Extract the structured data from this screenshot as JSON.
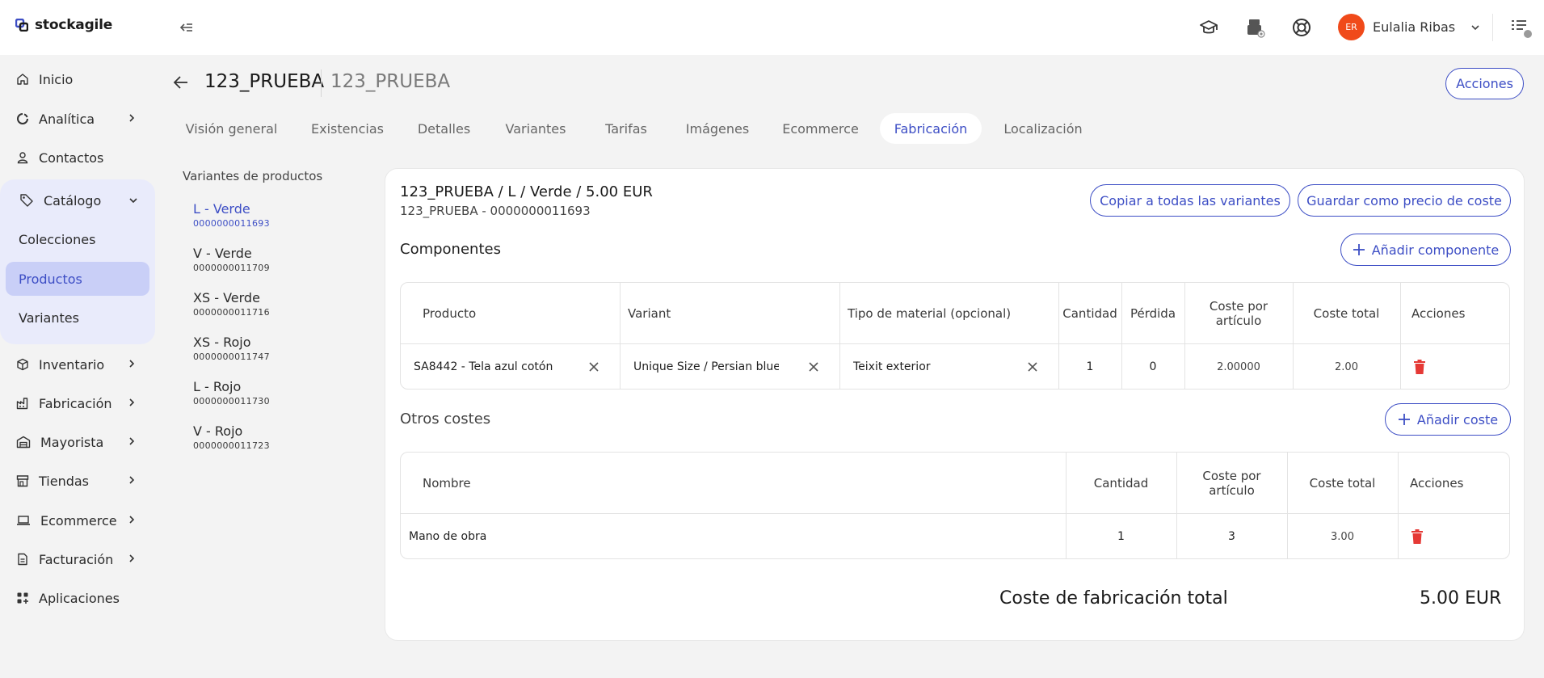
{
  "app": {
    "name": "stockagile"
  },
  "user": {
    "initials": "ER",
    "name": "Eulalia Ribas"
  },
  "colors": {
    "accent": "#3d4ec5",
    "avatar": "#f04a1a",
    "danger": "#e53935"
  },
  "sidebar": {
    "items": [
      {
        "label": "Inicio",
        "icon": "home-icon"
      },
      {
        "label": "Analítica",
        "icon": "analytics-icon"
      },
      {
        "label": "Contactos",
        "icon": "person-icon"
      },
      {
        "label": "Catálogo",
        "icon": "tag-icon"
      },
      {
        "label": "Inventario",
        "icon": "box-icon"
      },
      {
        "label": "Fabricación",
        "icon": "factory-icon"
      },
      {
        "label": "Mayorista",
        "icon": "warehouse-icon"
      },
      {
        "label": "Tiendas",
        "icon": "store-icon"
      },
      {
        "label": "Ecommerce",
        "icon": "laptop-icon"
      },
      {
        "label": "Facturación",
        "icon": "invoice-icon"
      },
      {
        "label": "Aplicaciones",
        "icon": "apps-icon"
      }
    ],
    "catalog_sub": [
      {
        "label": "Colecciones"
      },
      {
        "label": "Productos"
      },
      {
        "label": "Variantes"
      }
    ]
  },
  "header": {
    "title": "123_PRUEBA",
    "subtitle": "123_PRUEBA",
    "actions_label": "Acciones"
  },
  "tabs": [
    {
      "label": "Visión general"
    },
    {
      "label": "Existencias"
    },
    {
      "label": "Detalles"
    },
    {
      "label": "Variantes"
    },
    {
      "label": "Tarifas"
    },
    {
      "label": "Imágenes"
    },
    {
      "label": "Ecommerce"
    },
    {
      "label": "Fabricación"
    },
    {
      "label": "Localización"
    }
  ],
  "variants": {
    "heading": "Variantes de productos",
    "items": [
      {
        "name": "L - Verde",
        "code": "0000000011693"
      },
      {
        "name": "V - Verde",
        "code": "0000000011709"
      },
      {
        "name": "XS - Verde",
        "code": "0000000011716"
      },
      {
        "name": "XS - Rojo",
        "code": "0000000011747"
      },
      {
        "name": "L - Rojo",
        "code": "0000000011730"
      },
      {
        "name": "V - Rojo",
        "code": "0000000011723"
      }
    ]
  },
  "panel": {
    "title": "123_PRUEBA / L / Verde / 5.00 EUR",
    "subtitle": "123_PRUEBA - 0000000011693",
    "copy_all_label": "Copiar a todas las variantes",
    "save_cost_label": "Guardar como precio de coste",
    "components": {
      "title": "Componentes",
      "add_label": "Añadir componente",
      "headers": {
        "product": "Producto",
        "variant": "Variant",
        "material": "Tipo de material (opcional)",
        "quantity": "Cantidad",
        "loss": "Pérdida",
        "unit_cost": "Coste por artículo",
        "total_cost": "Coste total",
        "actions": "Acciones"
      },
      "rows": [
        {
          "product": "SA8442 - Tela azul cotón",
          "variant": "Unique Size / Persian blue",
          "material": "Teixit exterior",
          "quantity": "1",
          "loss": "0",
          "unit_cost": "2.00000",
          "total_cost": "2.00"
        }
      ]
    },
    "other_costs": {
      "title": "Otros costes",
      "add_label": "Añadir coste",
      "headers": {
        "name": "Nombre",
        "quantity": "Cantidad",
        "unit_cost": "Coste por artículo",
        "total_cost": "Coste total",
        "actions": "Acciones"
      },
      "rows": [
        {
          "name": "Mano de obra",
          "quantity": "1",
          "unit_cost": "3",
          "total_cost": "3.00"
        }
      ]
    },
    "total": {
      "label": "Coste de fabricación total",
      "value": "5.00 EUR"
    }
  }
}
